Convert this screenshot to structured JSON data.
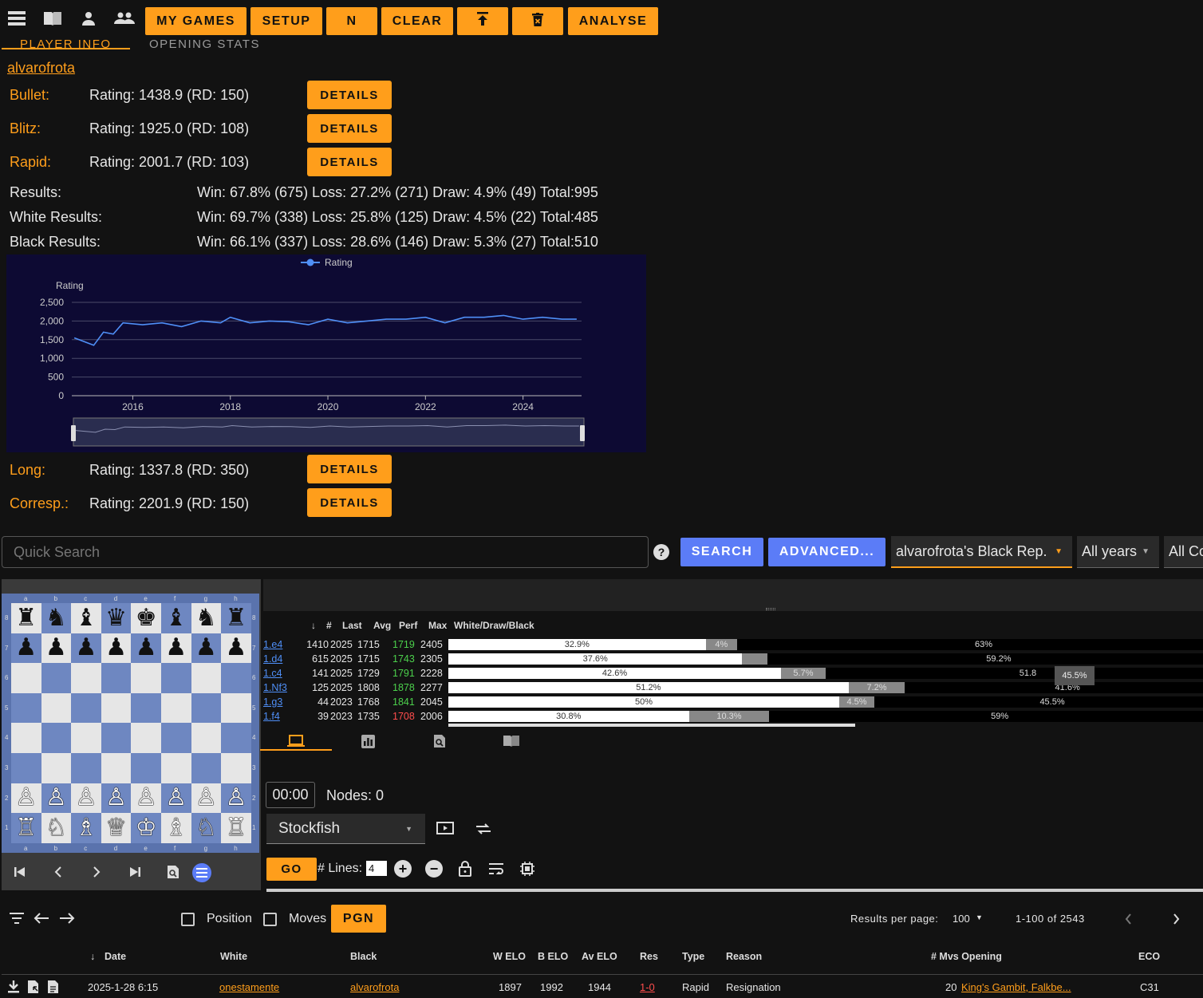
{
  "toolbar": {
    "buttons": [
      "MY GAMES",
      "SETUP",
      "N",
      "CLEAR",
      "ANALYSE"
    ]
  },
  "tabs": {
    "player_info": "PLAYER INFO",
    "opening_stats": "OPENING STATS"
  },
  "player": {
    "name": "alvarofrota"
  },
  "ratings": [
    {
      "label": "Bullet:",
      "value": "Rating: 1438.9 (RD: 150)",
      "button": "DETAILS"
    },
    {
      "label": "Blitz:",
      "value": "Rating: 1925.0 (RD: 108)",
      "button": "DETAILS"
    },
    {
      "label": "Rapid:",
      "value": "Rating: 2001.7 (RD: 103)",
      "button": "DETAILS"
    },
    {
      "label": "Long:",
      "value": "Rating: 1337.8 (RD: 350)",
      "button": "DETAILS"
    },
    {
      "label": "Corresp.:",
      "value": "Rating: 2201.9 (RD: 150)",
      "button": "DETAILS"
    }
  ],
  "results": [
    {
      "label": "Results:",
      "value": "Win: 67.8% (675) Loss: 27.2% (271) Draw: 4.9% (49) Total:995"
    },
    {
      "label": "White Results:",
      "value": "Win: 69.7% (338) Loss: 25.8% (125) Draw: 4.5% (22) Total:485"
    },
    {
      "label": "Black Results:",
      "value": "Win: 66.1% (337) Loss: 28.6% (146) Draw: 5.3% (27) Total:510"
    }
  ],
  "chart_data": {
    "type": "line",
    "legend": "Rating",
    "ylabel": "Rating",
    "ylim": [
      0,
      2500
    ],
    "yticks": [
      "0",
      "500",
      "1,000",
      "1,500",
      "2,000",
      "2,500"
    ],
    "xticks": [
      "2016",
      "2018",
      "2020",
      "2022",
      "2024"
    ],
    "x": [
      2014.8,
      2015.2,
      2015.4,
      2015.6,
      2015.8,
      2016.2,
      2016.6,
      2017.0,
      2017.4,
      2017.8,
      2018.0,
      2018.4,
      2018.8,
      2019.2,
      2019.6,
      2020.0,
      2020.4,
      2020.8,
      2021.2,
      2021.6,
      2022.0,
      2022.4,
      2022.8,
      2023.2,
      2023.6,
      2024.0,
      2024.4,
      2024.8,
      2025.1
    ],
    "values": [
      1550,
      1350,
      1700,
      1650,
      1950,
      1900,
      1950,
      1850,
      2000,
      1950,
      2100,
      1950,
      2000,
      1980,
      1900,
      2050,
      1950,
      2000,
      2050,
      2050,
      2100,
      1950,
      2100,
      2100,
      2150,
      2050,
      2100,
      2050,
      2050
    ],
    "series": [
      {
        "name": "Rating"
      }
    ]
  },
  "search": {
    "placeholder": "Quick Search",
    "help": "?",
    "search_btn": "SEARCH",
    "advanced_btn": "ADVANCED...",
    "rep_select": "alvarofrota's Black Rep.",
    "years_select": "All years",
    "colors_select": "All Co"
  },
  "board": {
    "files": [
      "a",
      "b",
      "c",
      "d",
      "e",
      "f",
      "g",
      "h"
    ],
    "ranks": [
      "8",
      "7",
      "6",
      "5",
      "4",
      "3",
      "2",
      "1"
    ],
    "rows": [
      [
        "♜",
        "♞",
        "♝",
        "♛",
        "♚",
        "♝",
        "♞",
        "♜"
      ],
      [
        "♟",
        "♟",
        "♟",
        "♟",
        "♟",
        "♟",
        "♟",
        "♟"
      ],
      [
        "",
        "",
        "",
        "",
        "",
        "",
        "",
        ""
      ],
      [
        "",
        "",
        "",
        "",
        "",
        "",
        "",
        ""
      ],
      [
        "",
        "",
        "",
        "",
        "",
        "",
        "",
        ""
      ],
      [
        "",
        "",
        "",
        "",
        "",
        "",
        "",
        ""
      ],
      [
        "♙",
        "♙",
        "♙",
        "♙",
        "♙",
        "♙",
        "♙",
        "♙"
      ],
      [
        "♖",
        "♘",
        "♗",
        "♕",
        "♔",
        "♗",
        "♘",
        "♖"
      ]
    ]
  },
  "moves": {
    "headers": [
      "#",
      "Last",
      "Avg",
      "Perf",
      "Max",
      "White/Draw/Black"
    ],
    "rows": [
      {
        "move": "1.e4",
        "n": "1410",
        "last": "2025",
        "avg": "1715",
        "perf": "1719",
        "perf_color": "#4cd04c",
        "max": "2405",
        "w": 32.9,
        "d": 4,
        "b": 63,
        "wl": "32.9%",
        "dl": "4%",
        "bl": "63%"
      },
      {
        "move": "1.d4",
        "n": "615",
        "last": "2025",
        "avg": "1715",
        "perf": "1743",
        "perf_color": "#4cd04c",
        "max": "2305",
        "w": 37.6,
        "d": 3.2,
        "b": 59.2,
        "wl": "37.6%",
        "dl": "",
        "bl": "59.2%"
      },
      {
        "move": "1.c4",
        "n": "141",
        "last": "2025",
        "avg": "1729",
        "perf": "1791",
        "perf_color": "#4cd04c",
        "max": "2228",
        "w": 42.6,
        "d": 5.7,
        "b": 51.8,
        "wl": "42.6%",
        "dl": "5.7%",
        "bl": "51.8"
      },
      {
        "move": "1.Nf3",
        "n": "125",
        "last": "2025",
        "avg": "1808",
        "perf": "1878",
        "perf_color": "#4cd04c",
        "max": "2277",
        "w": 51.2,
        "d": 7.2,
        "b": 41.6,
        "wl": "51.2%",
        "dl": "7.2%",
        "bl": "41.6%"
      },
      {
        "move": "1.g3",
        "n": "44",
        "last": "2023",
        "avg": "1768",
        "perf": "1841",
        "perf_color": "#4cd04c",
        "max": "2045",
        "w": 50,
        "d": 4.5,
        "b": 45.5,
        "wl": "50%",
        "dl": "4.5%",
        "bl": "45.5%"
      },
      {
        "move": "1.f4",
        "n": "39",
        "last": "2023",
        "avg": "1735",
        "perf": "1708",
        "perf_color": "#ff4d4d",
        "max": "2006",
        "w": 30.8,
        "d": 10.3,
        "b": 59,
        "wl": "30.8%",
        "dl": "10.3%",
        "bl": "59%"
      }
    ],
    "tooltip": "45.5%"
  },
  "engine": {
    "time": "00:00",
    "nodes": "Nodes: 0",
    "engine_select": "Stockfish",
    "go": "GO",
    "lines_label": "# Lines:",
    "lines_value": "4"
  },
  "games": {
    "position_label": "Position",
    "moves_label": "Moves",
    "pgn_btn": "PGN",
    "rpp_label": "Results per page:",
    "rpp_value": "100",
    "range": "1-100 of 2543",
    "headers": [
      "Date",
      "White",
      "Black",
      "W ELO",
      "B ELO",
      "Av ELO",
      "Res",
      "Type",
      "Reason",
      "# Mvs Opening",
      "ECO"
    ],
    "rows": [
      {
        "date": "2025-1-28 6:15",
        "white": "onestamente",
        "black": "alvarofrota",
        "welo": "1897",
        "belo": "1992",
        "avelo": "1944",
        "res": "1-0",
        "type": "Rapid",
        "reason": "Resignation",
        "mvs": "20",
        "opening": "King's Gambit, Falkbe...",
        "eco": "C31"
      }
    ]
  },
  "colors": {
    "accent": "#ff9e1b",
    "blue": "#5b7cf7",
    "chart_bg": "#0d0a33",
    "line": "#4f8ff7"
  }
}
